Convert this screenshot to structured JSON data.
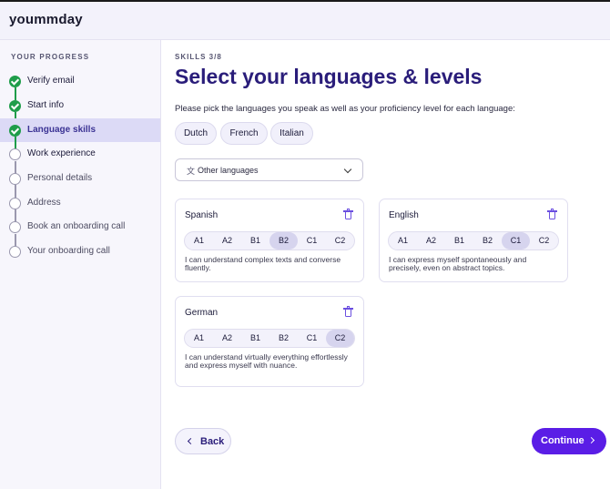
{
  "app": {
    "brand": "yoummday"
  },
  "sidebar": {
    "title": "YOUR PROGRESS",
    "steps": [
      {
        "label": "Verify email",
        "status": "done"
      },
      {
        "label": "Start info",
        "status": "done"
      },
      {
        "label": "Language skills",
        "status": "done",
        "active": true
      },
      {
        "label": "Work experience",
        "status": "todo"
      },
      {
        "label": "Personal details",
        "status": "todo"
      },
      {
        "label": "Address",
        "status": "todo"
      },
      {
        "label": "Book an onboarding call",
        "status": "todo"
      },
      {
        "label": "Your onboarding call",
        "status": "todo"
      }
    ]
  },
  "main": {
    "eyebrow": "SKILLS 3/8",
    "title": "Select your languages & levels",
    "subtitle": "Please pick the languages you speak as well as your proficiency level for each language:",
    "chips": [
      "Dutch",
      "French",
      "Italian"
    ],
    "other_select": {
      "label": "Other languages",
      "icon": "translate-icon"
    },
    "languages": [
      {
        "name": "Spanish",
        "selected_level": "B2",
        "description": "I can understand complex texts and converse fluently."
      },
      {
        "name": "English",
        "selected_level": "C1",
        "description": "I can express myself spontaneously and precisely, even on abstract topics."
      },
      {
        "name": "German",
        "selected_level": "C2",
        "description": "I can understand virtually everything effortlessly and express myself with nuance."
      }
    ],
    "levels": [
      "A1",
      "A2",
      "B1",
      "B2",
      "C1",
      "C2"
    ]
  },
  "footer": {
    "back_label": "Back",
    "continue_label": "Continue"
  },
  "colors": {
    "accent": "#5a1de6",
    "done": "#1f9d4a",
    "title": "#2a1d7a"
  }
}
